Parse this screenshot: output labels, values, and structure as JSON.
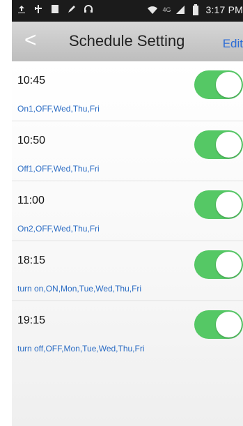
{
  "status_bar": {
    "time": "3:17 PM",
    "network_label": "4G",
    "icons": [
      "upload-icon",
      "usb-icon",
      "notification-icon",
      "pen-icon",
      "headset-icon",
      "wifi-icon",
      "signal-icon",
      "battery-icon"
    ]
  },
  "nav": {
    "back_label": "<",
    "title": "Schedule Setting",
    "edit_label": "Edit"
  },
  "schedules": [
    {
      "time": "10:45",
      "desc": "On1,OFF,Wed,Thu,Fri",
      "enabled": true
    },
    {
      "time": "10:50",
      "desc": "Off1,OFF,Wed,Thu,Fri",
      "enabled": true
    },
    {
      "time": "11:00",
      "desc": "On2,OFF,Wed,Thu,Fri",
      "enabled": true
    },
    {
      "time": "18:15",
      "desc": "turn on,ON,Mon,Tue,Wed,Thu,Fri",
      "enabled": true
    },
    {
      "time": "19:15",
      "desc": "turn off,OFF,Mon,Tue,Wed,Thu,Fri",
      "enabled": true
    }
  ],
  "colors": {
    "toggle_on": "#55c865",
    "desc_text": "#2b6cc4",
    "edit_text": "#2b6bd6"
  }
}
